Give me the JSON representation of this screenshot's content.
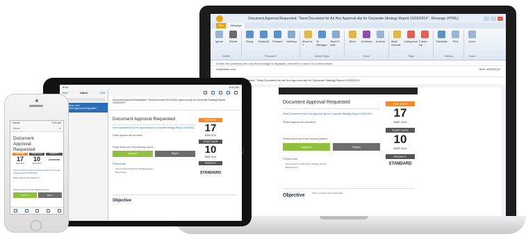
{
  "email": {
    "heading": "Document Approval Requested",
    "heading_phone": "Document Approval Requested",
    "doc_link": "Send Document for Ad Hoc Approval slip for Corporate Strategy Report 10/03/2014",
    "intro": "Please approve this document.",
    "instruction": "Please select one of the following actions:",
    "approve_label": "Approve",
    "reject_label": "Reject",
    "previous_task": "Previous task",
    "prev_line1": "Sent for Ad hoc Approval to Strategy Report",
    "prev_line2": "Brand Owner",
    "due_label": "DUE DATE",
    "due_day": "17",
    "due_month": "MAR 2014",
    "start_label": "START DATE",
    "start_day": "10",
    "start_month": "MAR 2014",
    "priority_label": "PRIORITY",
    "priority_value": "STANDARD",
    "footer_logo": "Objective",
    "footer_note": "This is a system generated email."
  },
  "outlook": {
    "title": "Document Approval Requested: \"Send Document for Ad Hoc Approval slip for Corporate Strategy Report 10/03/2014\" - Message (HTML)",
    "tabs": [
      "File",
      "Message"
    ],
    "ribbon_groups": [
      {
        "label": "Delete",
        "buttons": [
          "Ignore",
          "Delete"
        ]
      },
      {
        "label": "Respond",
        "buttons": [
          "Reply",
          "Reply All",
          "Forward",
          "Meeting"
        ]
      },
      {
        "label": "Quick Steps",
        "buttons": [
          "Move to: ?",
          "To Manager",
          "Team E-mail"
        ]
      },
      {
        "label": "Move",
        "buttons": [
          "Move",
          "OneNote",
          "Actions"
        ]
      },
      {
        "label": "Tags",
        "buttons": [
          "Mark Unread",
          "Categorize",
          "Follow Up"
        ]
      },
      {
        "label": "Editing",
        "buttons": [
          "Translate",
          "Find"
        ]
      },
      {
        "label": "Zoom",
        "buttons": [
          "Zoom"
        ]
      }
    ],
    "info_bar": "If there are problems with how this message is displayed, click here to view it in a web browser.",
    "from": "ecf@demo.com",
    "sent": "Sent: 10/03/2014",
    "subject": "Document Approval Requested: \"Send Document for Ad Hoc Approval slip for Corporate Strategy Report 10/03/2014\""
  },
  "tablet": {
    "status_left": "iPad",
    "status_right": "9:41 AM",
    "back_label": "Mail",
    "inbox_title": "Inbox",
    "edit_label": "Edit",
    "message_from": "ecf@demo.com",
    "message_preview": "Document Approval Requested",
    "header_subject": "Document Approval Requested: \"Send Document for Ad Hoc Approval slip for Corporate Strategy Report 10/03/2014\""
  },
  "phone": {
    "status_left": "Carrier",
    "status_right": "9:41 AM",
    "back_label": "Inbox"
  },
  "colors": {
    "orange": "#f08a2c",
    "green": "#8fc13e",
    "grey": "#6d6d6d",
    "link": "#2a6fb5"
  }
}
